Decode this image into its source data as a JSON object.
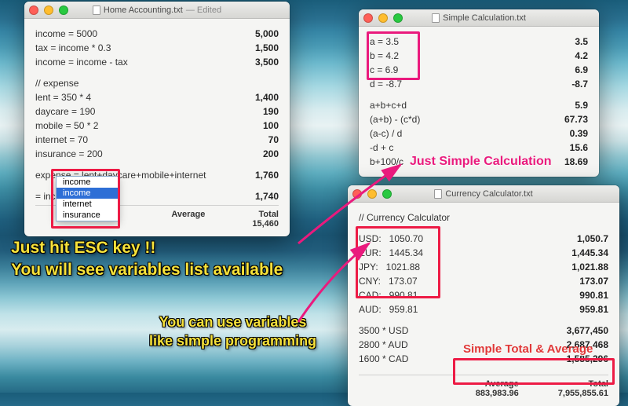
{
  "win1": {
    "title": "Home Accounting.txt",
    "edited": "Edited",
    "lines": [
      {
        "l": "income = 5000",
        "r": "5,000"
      },
      {
        "l": "tax = income * 0.3",
        "r": "1,500"
      },
      {
        "l": "income = income - tax",
        "r": "3,500"
      },
      {
        "l": "",
        "r": ""
      },
      {
        "l": "// expense",
        "r": ""
      },
      {
        "l": "lent = 350 * 4",
        "r": "1,400"
      },
      {
        "l": "daycare = 190",
        "r": "190"
      },
      {
        "l": "mobile = 50 * 2",
        "r": "100"
      },
      {
        "l": "internet = 70",
        "r": "70"
      },
      {
        "l": "insurance = 200",
        "r": "200"
      },
      {
        "l": "",
        "r": ""
      },
      {
        "l": "expense = lent+daycare+mobile+internet",
        "r": "1,760"
      },
      {
        "l": "",
        "r": ""
      },
      {
        "l": "= income - expense",
        "r": "1,740"
      }
    ],
    "autocomplete": {
      "items": [
        "income",
        "income",
        "internet",
        "insurance"
      ],
      "selected": 1
    },
    "avg_label": "Average",
    "avg_val": "",
    "total_label": "Total",
    "total_val": "15,460"
  },
  "win2": {
    "title": "Simple Calculation.txt",
    "lines": [
      {
        "l": "a = 3.5",
        "r": "3.5"
      },
      {
        "l": "b = 4.2",
        "r": "4.2"
      },
      {
        "l": "c = 6.9",
        "r": "6.9"
      },
      {
        "l": "d = -8.7",
        "r": "-8.7"
      },
      {
        "l": "",
        "r": ""
      },
      {
        "l": "a+b+c+d",
        "r": "5.9"
      },
      {
        "l": "(a+b) - (c*d)",
        "r": "67.73"
      },
      {
        "l": "(a-c) / d",
        "r": "0.39"
      },
      {
        "l": "-d + c",
        "r": "15.6"
      },
      {
        "l": "b+100/c",
        "r": "18.69"
      }
    ]
  },
  "win3": {
    "title": "Currency Calculator.txt",
    "header": "// Currency Calculator",
    "lines": [
      {
        "l": "USD:   1050.70",
        "r": "1,050.7"
      },
      {
        "l": "EUR:   1445.34",
        "r": "1,445.34"
      },
      {
        "l": "JPY:   1021.88",
        "r": "1,021.88"
      },
      {
        "l": "CNY:   173.07",
        "r": "173.07"
      },
      {
        "l": "CAD:   990.81",
        "r": "990.81"
      },
      {
        "l": "AUD:   959.81",
        "r": "959.81"
      },
      {
        "l": "",
        "r": ""
      },
      {
        "l": "3500 * USD",
        "r": "3,677,450"
      },
      {
        "l": "2800 * AUD",
        "r": "2,687,468"
      },
      {
        "l": "1600 * CAD",
        "r": "1,585,296"
      }
    ],
    "avg_label": "Average",
    "avg_val": "883,983.96",
    "total_label": "Total",
    "total_val": "7,955,855.61"
  },
  "callouts": {
    "c1": "Just hit ESC key !!\nYou will see variables list available",
    "c2": "You can use variables\nlike simple programming",
    "c3": "Just Simple Calculation",
    "c4": "Simple Total & Average"
  }
}
